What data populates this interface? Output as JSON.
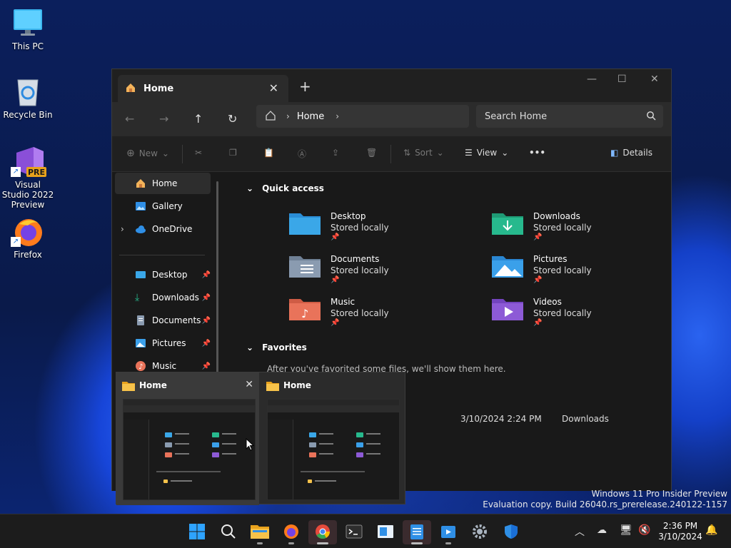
{
  "desktop": {
    "icons": [
      {
        "label": "This PC"
      },
      {
        "label": "Recycle Bin"
      },
      {
        "label": "Visual Studio 2022 Preview",
        "badge": "PRE"
      },
      {
        "label": "Firefox"
      }
    ]
  },
  "explorer": {
    "tab_title": "Home",
    "breadcrumb": "Home",
    "search_placeholder": "Search Home",
    "commands": {
      "new": "New",
      "sort": "Sort",
      "view": "View",
      "more": "•••",
      "details": "Details"
    },
    "nav": {
      "top": [
        {
          "label": "Home",
          "icon": "home-icon"
        },
        {
          "label": "Gallery",
          "icon": "gallery-icon"
        },
        {
          "label": "OneDrive",
          "icon": "cloud-icon"
        }
      ],
      "pinned": [
        {
          "label": "Desktop",
          "icon": "desktop-folder-icon"
        },
        {
          "label": "Downloads",
          "icon": "download-icon"
        },
        {
          "label": "Documents",
          "icon": "documents-icon"
        },
        {
          "label": "Pictures",
          "icon": "pictures-icon"
        },
        {
          "label": "Music",
          "icon": "music-icon"
        }
      ]
    },
    "quick_access_header": "Quick access",
    "quick_access": [
      {
        "name": "Desktop",
        "status": "Stored locally",
        "color": "#3aa7e8"
      },
      {
        "name": "Downloads",
        "status": "Stored locally",
        "color": "#27b98d"
      },
      {
        "name": "Documents",
        "status": "Stored locally",
        "color": "#8a9bb0"
      },
      {
        "name": "Pictures",
        "status": "Stored locally",
        "color": "#3aa0ea"
      },
      {
        "name": "Music",
        "status": "Stored locally",
        "color": "#e9735a"
      },
      {
        "name": "Videos",
        "status": "Stored locally",
        "color": "#8d5ad6"
      }
    ],
    "favorites_header": "Favorites",
    "favorites_empty": "After you've favorited some files, we'll show them here.",
    "recent": {
      "date": "3/10/2024 2:24 PM",
      "location": "Downloads"
    }
  },
  "thumbnails": [
    {
      "title": "Home"
    },
    {
      "title": "Home"
    }
  ],
  "watermark": {
    "line1": "Windows 11 Pro Insider Preview",
    "line2": "Evaluation copy. Build 26040.rs_prerelease.240122-1157"
  },
  "clock": {
    "time": "2:36 PM",
    "date": "3/10/2024"
  },
  "colors": {
    "accent": "#0078d4",
    "chrome_active": "#e64a3c"
  }
}
